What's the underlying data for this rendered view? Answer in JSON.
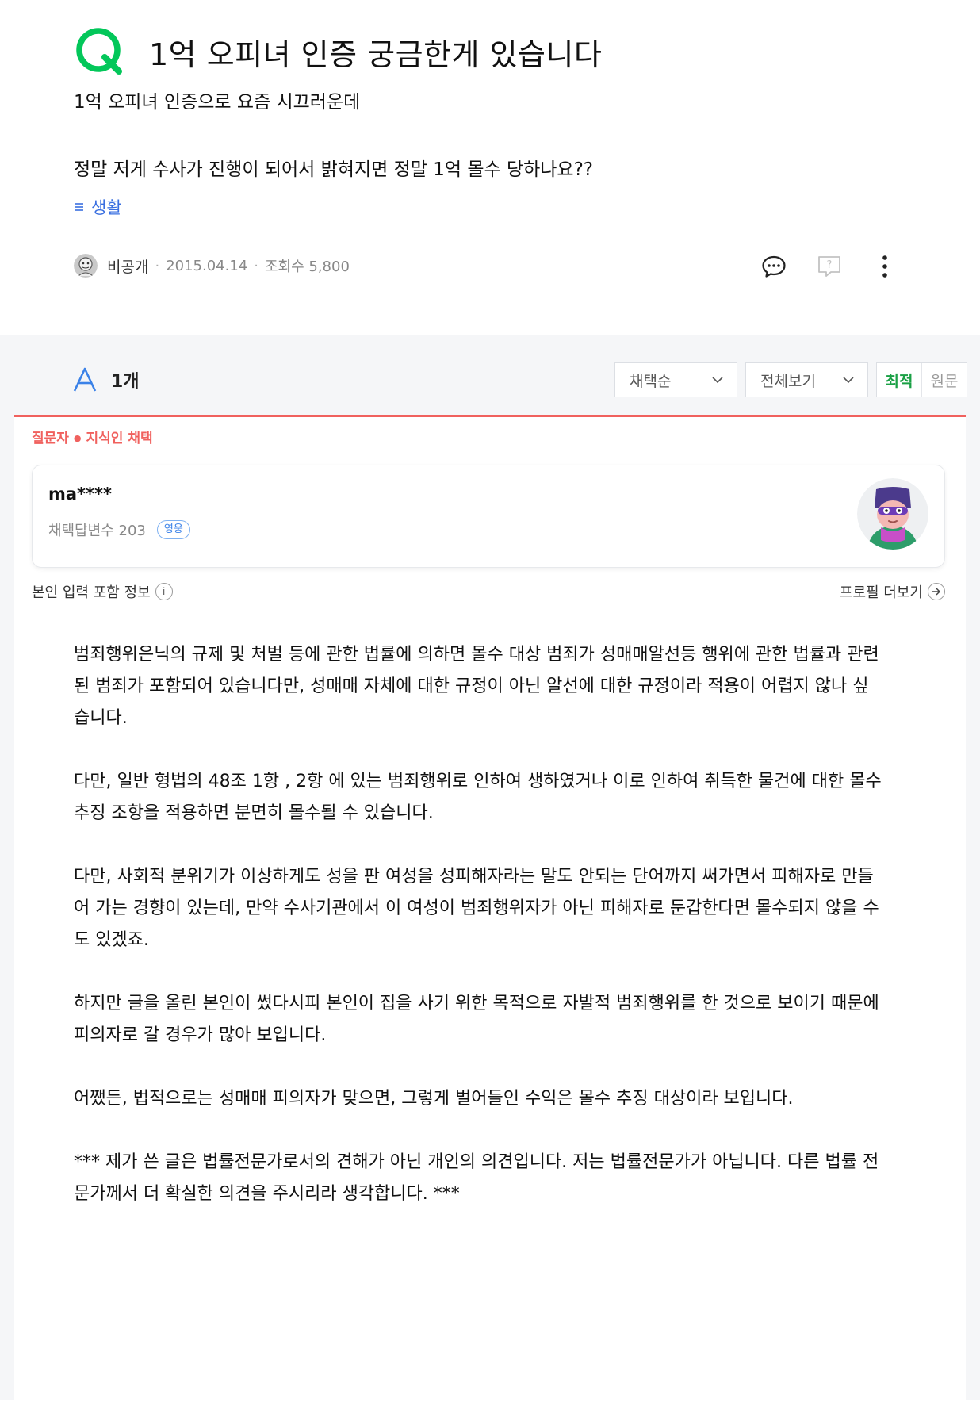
{
  "question": {
    "title": "1억 오피녀 인증 궁금한게 있습니다",
    "body_lines": [
      "1억 오피녀 인증으로 요즘 시끄러운데",
      "정말 저게 수사가 진행이 되어서 밝혀지면 정말 1억 몰수 당하나요??"
    ],
    "category": "생활",
    "author": "비공개",
    "date": "2015.04.14",
    "views": "조회수 5,800",
    "actions": [
      "comment-icon",
      "question-report-icon",
      "more-icon"
    ]
  },
  "answers": {
    "count_label": "1개",
    "sort_label": "채택순",
    "filter_label": "전체보기",
    "toggle_active": "최적",
    "toggle_inactive": "원문",
    "choice_label_1": "질문자",
    "choice_label_2": "지식인 채택",
    "answerer": {
      "name": "ma****",
      "stat": "채택답변수 203",
      "rank": "영웅"
    },
    "info_left": "본인 입력 포함 정보",
    "info_right": "프로필 더보기",
    "paragraphs": [
      "범죄행위은닉의 규제 및 처벌 등에 관한 법률에 의하면 몰수 대상 범죄가 성매매알선등 행위에 관한 법률과 관련된 범죄가 포함되어 있습니다만, 성매매 자체에 대한 규정이 아닌 알선에 대한 규정이라 적용이 어렵지 않나 싶습니다.",
      "다만, 일반 형법의 48조 1항 , 2항 에 있는 범죄행위로 인하여 생하였거나 이로 인하여 취득한 물건에 대한 몰수 추징 조항을 적용하면 분면히 몰수될 수 있습니다.",
      "다만, 사회적 분위기가 이상하게도 성을 판 여성을 성피해자라는 말도 안되는 단어까지 써가면서 피해자로 만들어 가는 경향이 있는데, 만약 수사기관에서 이 여성이 범죄행위자가 아닌 피해자로 둔갑한다면 몰수되지 않을 수도 있겠죠.",
      "하지만 글을 올린 본인이 썼다시피 본인이 집을 사기 위한 목적으로 자발적 범죄행위를 한 것으로 보이기 때문에 피의자로 갈 경우가 많아 보입니다.",
      "어쨌든, 법적으로는 성매매 피의자가 맞으면, 그렇게 벌어들인 수익은 몰수 추징 대상이라 보입니다.",
      "*** 제가 쓴 글은 법률전문가로서의 견해가 아닌 개인의 의견입니다. 저는 법률전문가가 아닙니다. 다른 법률 전문가께서 더 확실한 의견을 주시리라 생각합니다. ***"
    ]
  },
  "colors": {
    "q_green": "#03c75a",
    "a_blue": "#3b82e8",
    "choice_red": "#f0615e",
    "category_blue": "#3a6fe0"
  }
}
